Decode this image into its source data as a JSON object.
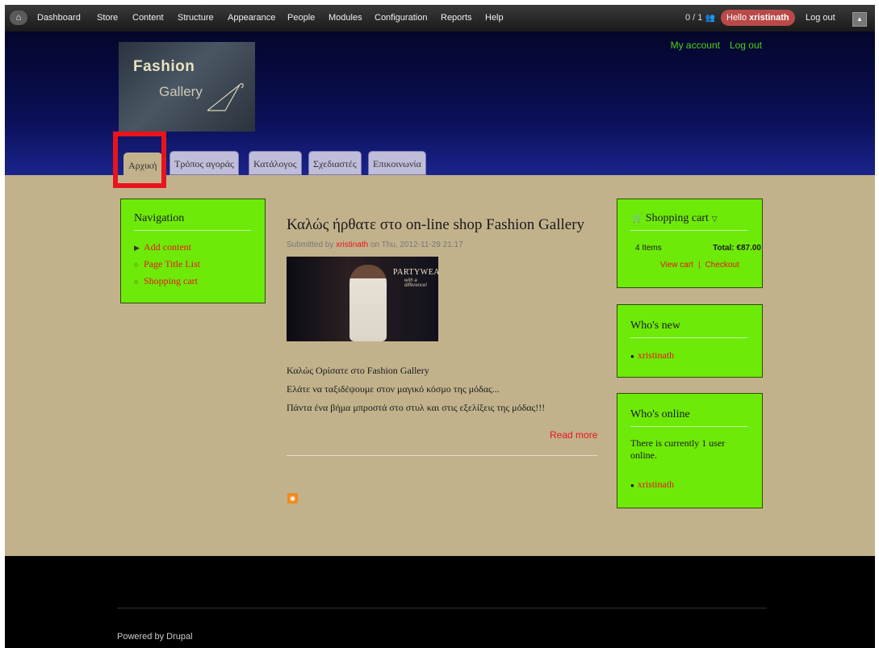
{
  "toolbar": {
    "items": [
      "Dashboard",
      "Store",
      "Content",
      "Structure",
      "Appearance",
      "People",
      "Modules",
      "Configuration",
      "Reports",
      "Help"
    ],
    "count": "0 / 1",
    "hello_prefix": "Hello",
    "username": "xristinath",
    "logout": "Log out"
  },
  "header": {
    "logo_line1": "Fashion",
    "logo_line2": "Gallery",
    "my_account": "My account",
    "logout": "Log out"
  },
  "tabs": [
    "Αρχική",
    "Τρόπος αγοράς",
    "Κατάλογος",
    "Σχεδιαστές",
    "Επικοινωνία"
  ],
  "navigation": {
    "title": "Navigation",
    "items": [
      "Add content",
      "Page Title List",
      "Shopping cart"
    ]
  },
  "article": {
    "title": "Καλώς ήρθατε στο on-line shop Fashion Gallery",
    "submitted_prefix": "Submitted by",
    "author": "xristinath",
    "date": "on Thu, 2012-11-29 21:17",
    "image_text1": "PARTYWEAR",
    "image_text2": "with a difference!",
    "lines": [
      "Καλώς Ορίσατε στο Fashion Gallery",
      "Ελάτε να ταξιδέψουμε στον μαγικό κόσμο της μόδας...",
      "Πάντα ένα βήμα μπροστά στο στυλ και στις εξελίξεις της μόδας!!!"
    ],
    "read_more": "Read more"
  },
  "cart": {
    "title": "Shopping cart",
    "items": "4 Items",
    "total": "Total: €87.00",
    "view_cart": "View cart",
    "checkout": "Checkout"
  },
  "whos_new": {
    "title": "Who's new",
    "user": "xristinath"
  },
  "whos_online": {
    "title": "Who's online",
    "text": "There is currently 1 user online.",
    "user": "xristinath"
  },
  "footer": {
    "powered": "Powered by Drupal"
  },
  "colors": {
    "block_green": "#6eea08",
    "link_red": "#e8141c",
    "page_bg": "#c2b28c",
    "highlight_red": "#e8141c"
  }
}
